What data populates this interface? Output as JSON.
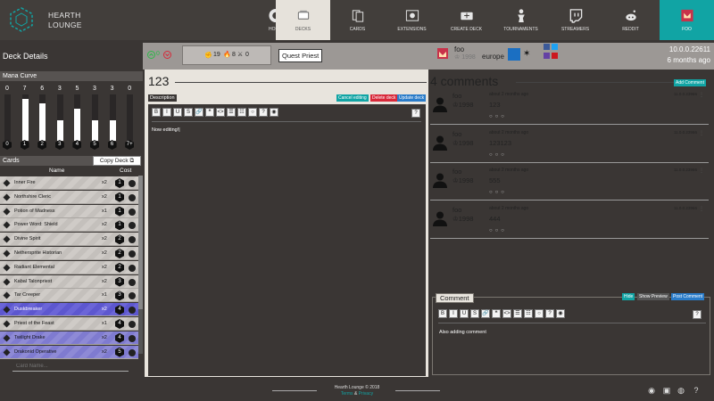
{
  "brand": {
    "name_line1": "HEARTH",
    "name_line2": "LOUNGE"
  },
  "nav": [
    {
      "label": "HOME",
      "icon": "hearthstone-logo-icon"
    },
    {
      "label": "DECKS",
      "icon": "decks-icon",
      "active": true
    },
    {
      "label": "CARDS",
      "icon": "cards-icon"
    },
    {
      "label": "EXTENSIONS",
      "icon": "extensions-icon"
    },
    {
      "label": "CREATE DECK",
      "icon": "create-deck-icon"
    },
    {
      "label": "TOURNAMENTS",
      "icon": "tournaments-icon"
    },
    {
      "label": "STREAMERS",
      "icon": "twitch-icon"
    },
    {
      "label": "REDDIT",
      "icon": "reddit-icon"
    },
    {
      "label": "FOO",
      "icon": "user-avatar-icon",
      "user": true
    }
  ],
  "header": {
    "title": "Deck Details",
    "votes": "0",
    "stats": {
      "minions": "19",
      "spells": "8",
      "weapons": "0"
    },
    "archetype": "Quest Priest",
    "author": {
      "name": "foo",
      "rating": "1998",
      "region": "europe"
    },
    "version": "10.0.0.22611",
    "age": "6 months ago"
  },
  "mana_curve": {
    "title": "Mana Curve",
    "counts": [
      "0",
      "7",
      "6",
      "3",
      "5",
      "3",
      "3",
      "0"
    ],
    "costs": [
      "0",
      "1",
      "2",
      "3",
      "4",
      "5",
      "6",
      "7+"
    ],
    "fill_fraction": [
      0,
      0.9,
      0.8,
      0.45,
      0.7,
      0.45,
      0.45,
      0
    ]
  },
  "cards_section": {
    "title": "Cards",
    "copy_label": "Copy Deck",
    "col_name": "Name",
    "col_cost": "Cost",
    "search_placeholder": "Card Name..."
  },
  "cards": [
    {
      "name": "Inner Fire",
      "qty": "x2",
      "cost": "1",
      "style": ""
    },
    {
      "name": "Northshire Cleric",
      "qty": "x2",
      "cost": "1",
      "style": ""
    },
    {
      "name": "Potion of Madness",
      "qty": "x1",
      "cost": "1",
      "style": ""
    },
    {
      "name": "Power Word: Shield",
      "qty": "x2",
      "cost": "1",
      "style": ""
    },
    {
      "name": "Divine Spirit",
      "qty": "x2",
      "cost": "2",
      "style": ""
    },
    {
      "name": "Nethersprite Historian",
      "qty": "x2",
      "cost": "2",
      "style": ""
    },
    {
      "name": "Radiant Elemental",
      "qty": "x2",
      "cost": "2",
      "style": ""
    },
    {
      "name": "Kabal Talonpriest",
      "qty": "x2",
      "cost": "3",
      "style": ""
    },
    {
      "name": "Tar Creeper",
      "qty": "x1",
      "cost": "3",
      "style": ""
    },
    {
      "name": "Duskbreaker",
      "qty": "x2",
      "cost": "4",
      "style": "sel"
    },
    {
      "name": "Priest of the Feast",
      "qty": "x1",
      "cost": "4",
      "style": ""
    },
    {
      "name": "Twilight Drake",
      "qty": "x2",
      "cost": "4",
      "style": "leg"
    },
    {
      "name": "Drakonid Operative",
      "qty": "x2",
      "cost": "5",
      "style": "leg"
    }
  ],
  "deck": {
    "name": "123",
    "description_label": "Description",
    "cancel_label": "Cancel editing",
    "delete_label": "Delete deck",
    "update_label": "Update deck",
    "editor_text": "Now editing!"
  },
  "toolbar": [
    "B",
    "I",
    "U",
    "S",
    "🔗",
    "❝",
    "<>",
    "☰",
    "☷",
    "○",
    "?",
    "◉"
  ],
  "comments": {
    "heading": "4 comments",
    "add_label": "Add Comment",
    "items": [
      {
        "user": "foo",
        "rating": "1998",
        "time": "about 2 months ago",
        "text": "123",
        "ip": "11.0.0.23966"
      },
      {
        "user": "foo",
        "rating": "1998",
        "time": "about 2 months ago",
        "text": "123123",
        "ip": "11.0.0.23966"
      },
      {
        "user": "foo",
        "rating": "1998",
        "time": "about 2 months ago",
        "text": "555",
        "ip": "11.0.0.23966"
      },
      {
        "user": "foo",
        "rating": "1998",
        "time": "about 2 months ago",
        "text": "444",
        "ip": "11.0.0.23966"
      }
    ],
    "new": {
      "label": "Comment",
      "hide_label": "Hide",
      "preview_label": "Show Preview",
      "post_label": "Post Comment",
      "text": "Also adding comment"
    }
  },
  "footer": {
    "copyright": "Hearth Lounge © 2018",
    "terms": "Terms",
    "amp": "&",
    "privacy": "Privacy"
  },
  "colors": {
    "accent": "#11a4a4",
    "danger": "#d8293a",
    "primary": "#2a7cc9",
    "legendary": "#8e8ad6"
  }
}
